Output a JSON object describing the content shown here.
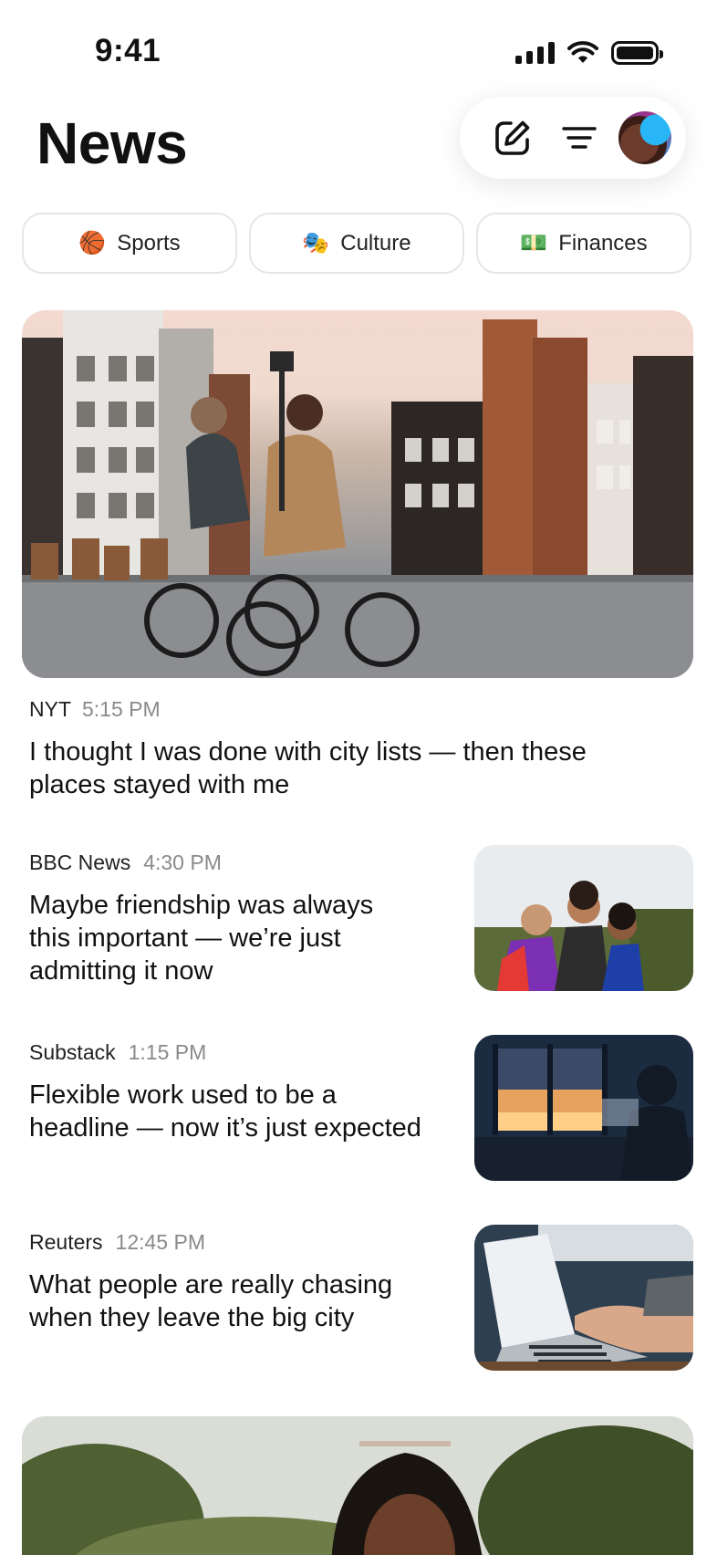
{
  "status_bar": {
    "time": "9:41"
  },
  "header": {
    "title": "News"
  },
  "chips": [
    {
      "icon": "🏀",
      "label": "Sports"
    },
    {
      "icon": "🎭",
      "label": "Culture"
    },
    {
      "icon": "💵",
      "label": "Finances"
    }
  ],
  "hero": {
    "source": "NYT",
    "time": "5:15 PM",
    "headline": "I thought I was done with city lists — then these places stayed with me"
  },
  "articles": [
    {
      "source": "BBC News",
      "time": "4:30 PM",
      "headline": "Maybe friendship was always this important — we’re just admitting it now"
    },
    {
      "source": "Substack",
      "time": "1:15 PM",
      "headline": "Flexible work used to be a headline — now it’s just expected"
    },
    {
      "source": "Reuters",
      "time": "12:45 PM",
      "headline": "What people are really chasing when they leave the big city"
    }
  ]
}
